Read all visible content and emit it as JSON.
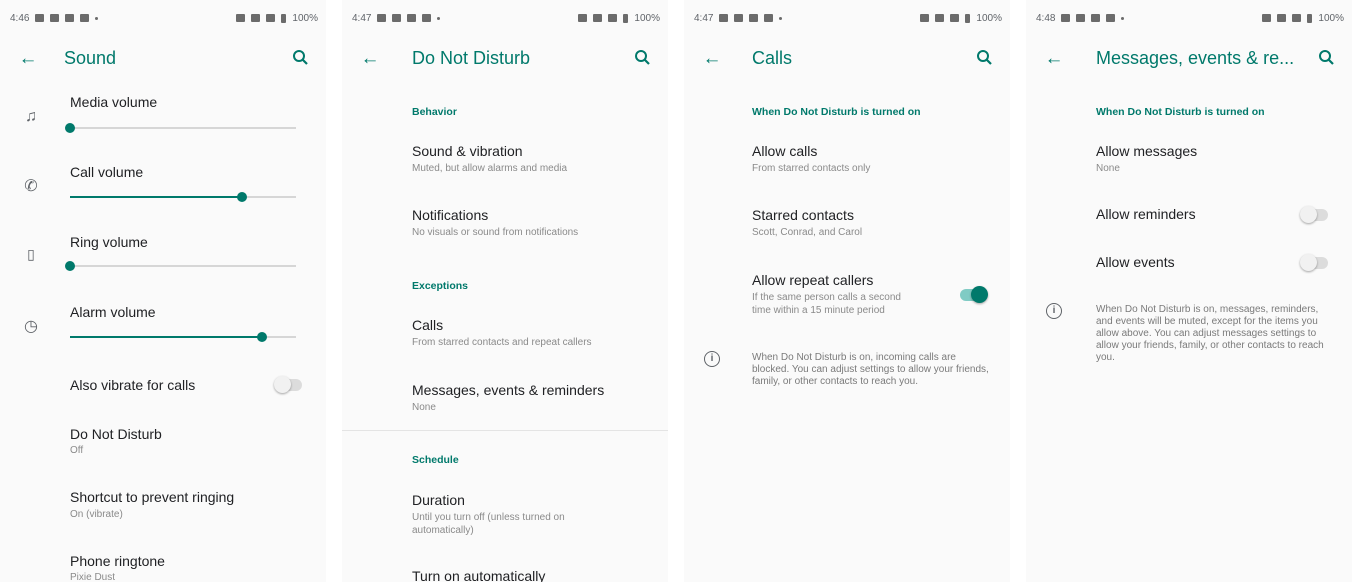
{
  "accent": "#00796b",
  "panels": [
    {
      "status": {
        "time": "4:46",
        "battery": "100%"
      },
      "title": "Sound",
      "rows": [
        {
          "label": "Media volume",
          "icon": "music-note-icon",
          "level": 0
        },
        {
          "label": "Call volume",
          "icon": "phone-icon",
          "level": 0.76
        },
        {
          "label": "Ring volume",
          "icon": "vibrate-icon",
          "level": 0
        },
        {
          "label": "Alarm volume",
          "icon": "alarm-icon",
          "level": 0.85
        }
      ],
      "vibrate_label": "Also vibrate for calls",
      "dnd": {
        "title": "Do Not Disturb",
        "sub": "Off"
      },
      "shortcut": {
        "title": "Shortcut to prevent ringing",
        "sub": "On (vibrate)"
      },
      "ringtone": {
        "title": "Phone ringtone",
        "sub": "Pixie Dust"
      }
    },
    {
      "status": {
        "time": "4:47",
        "battery": "100%"
      },
      "title": "Do Not Disturb",
      "behavior_header": "Behavior",
      "sound": {
        "title": "Sound & vibration",
        "sub": "Muted, but allow alarms and media"
      },
      "notifications": {
        "title": "Notifications",
        "sub": "No visuals or sound from notifications"
      },
      "exceptions_header": "Exceptions",
      "calls": {
        "title": "Calls",
        "sub": "From starred contacts and repeat callers"
      },
      "messages": {
        "title": "Messages, events & reminders",
        "sub": "None"
      },
      "schedule_header": "Schedule",
      "duration": {
        "title": "Duration",
        "sub1": "Until you turn off (unless turned on",
        "sub2": "automatically)"
      },
      "turn_on": {
        "title": "Turn on automatically"
      }
    },
    {
      "status": {
        "time": "4:47",
        "battery": "100%"
      },
      "title": "Calls",
      "header": "When Do Not Disturb is turned on",
      "allow_calls": {
        "title": "Allow calls",
        "sub": "From starred contacts only"
      },
      "starred": {
        "title": "Starred contacts",
        "sub": "Scott, Conrad, and Carol"
      },
      "repeat": {
        "title": "Allow repeat callers",
        "sub1": "If the same person calls a second",
        "sub2": "time within a 15 minute period",
        "on": true
      },
      "info": "When Do Not Disturb is on, incoming calls are blocked. You can adjust settings to allow your friends, family, or other contacts to reach you."
    },
    {
      "status": {
        "time": "4:48",
        "battery": "100%"
      },
      "title": "Messages, events & re...",
      "header": "When Do Not Disturb is turned on",
      "allow_messages": {
        "title": "Allow messages",
        "sub": "None"
      },
      "reminders": {
        "title": "Allow reminders",
        "on": false
      },
      "events": {
        "title": "Allow events",
        "on": false
      },
      "info": "When Do Not Disturb is on, messages, reminders, and events will be muted, except for the items you allow above. You can adjust messages settings to allow your friends, family, or other contacts to reach you."
    }
  ]
}
